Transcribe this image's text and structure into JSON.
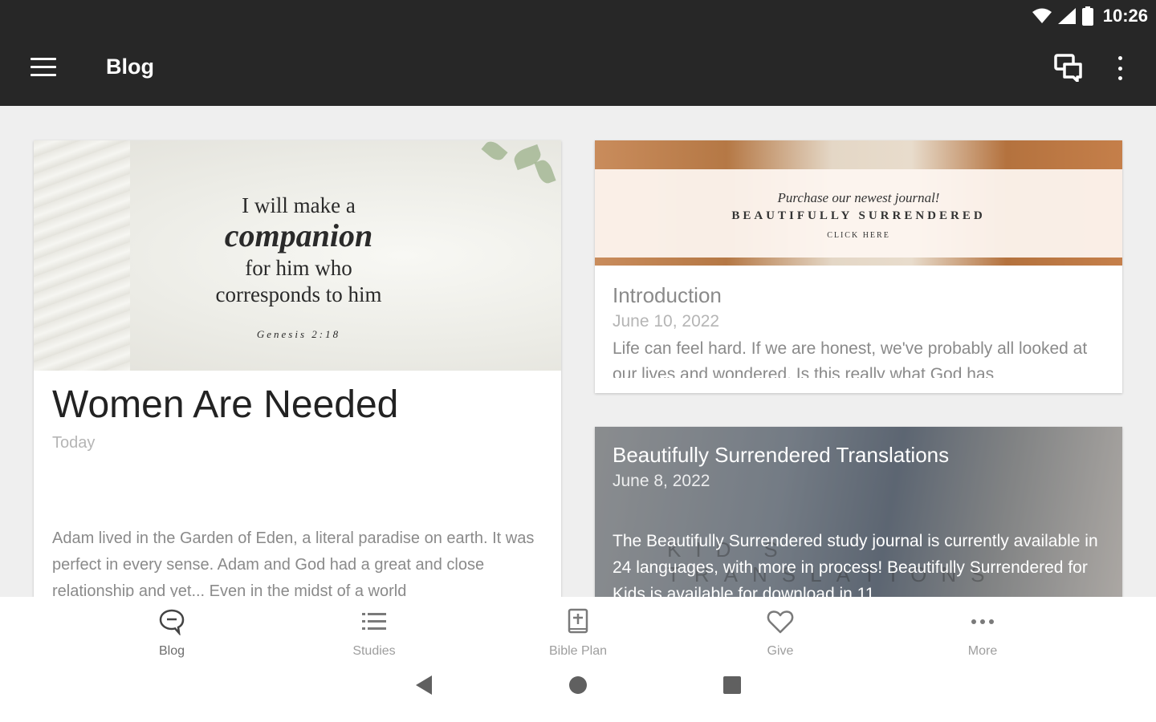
{
  "status_bar": {
    "time": "10:26"
  },
  "app_bar": {
    "title": "Blog"
  },
  "featured_post": {
    "image_quote": {
      "line1": "I will make a",
      "line2": "companion",
      "line3": "for him who",
      "line4": "corresponds to him",
      "reference": "Genesis 2:18"
    },
    "title": "Women Are Needed",
    "date": "Today",
    "excerpt": "Adam lived in the Garden of Eden, a literal paradise on earth. It was perfect in every sense. Adam and God had a great and close relationship and yet... Even in the midst of a world"
  },
  "posts": [
    {
      "banner": {
        "line1": "Purchase our newest journal!",
        "line2": "BEAUTIFULLY SURRENDERED",
        "line3": "CLICK HERE"
      },
      "title": "Introduction",
      "date": "June 10, 2022",
      "excerpt": "Life can feel hard. If we are honest, we've probably all looked at our lives and wondered. Is this really what God has"
    },
    {
      "watermark": "KID'S TRANSLATIONS",
      "title": "Beautifully Surrendered Translations",
      "date": "June 8, 2022",
      "excerpt": "The Beautifully Surrendered study journal is currently available in 24 languages, with more in process!  Beautifully Surrendered for Kids is available for download in 11"
    }
  ],
  "bottom_nav": [
    {
      "label": "Blog",
      "icon": "chat-bubble-icon",
      "active": true
    },
    {
      "label": "Studies",
      "icon": "list-icon",
      "active": false
    },
    {
      "label": "Bible Plan",
      "icon": "book-plus-icon",
      "active": false
    },
    {
      "label": "Give",
      "icon": "heart-icon",
      "active": false
    },
    {
      "label": "More",
      "icon": "more-dots-icon",
      "active": false
    }
  ],
  "colors": {
    "app_bar": "#272727",
    "background": "#efefef",
    "muted_text": "#8a8a8a"
  }
}
